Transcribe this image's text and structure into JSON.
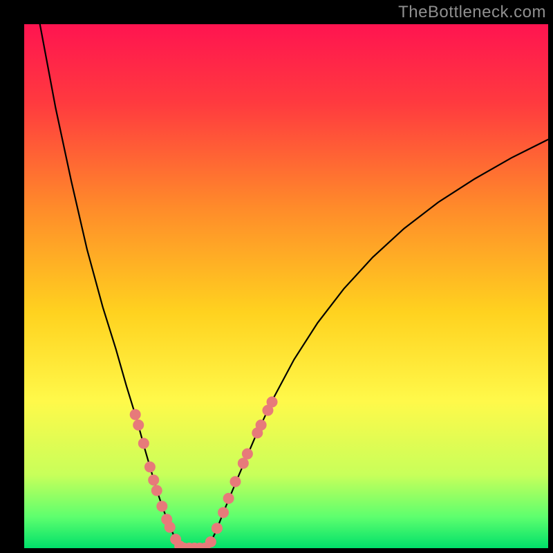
{
  "watermark": "TheBottleneck.com",
  "chart_data": {
    "type": "line",
    "title": "",
    "xlabel": "",
    "ylabel": "",
    "xlim": [
      0,
      100
    ],
    "ylim": [
      0,
      100
    ],
    "background": {
      "type": "vertical-gradient",
      "stops": [
        {
          "offset": 0,
          "color": "#ff1450"
        },
        {
          "offset": 15,
          "color": "#ff3a3f"
        },
        {
          "offset": 35,
          "color": "#ff8b2a"
        },
        {
          "offset": 55,
          "color": "#ffd21f"
        },
        {
          "offset": 72,
          "color": "#fff94a"
        },
        {
          "offset": 86,
          "color": "#c8ff5a"
        },
        {
          "offset": 94,
          "color": "#5eff6e"
        },
        {
          "offset": 100,
          "color": "#00e06a"
        }
      ]
    },
    "series": [
      {
        "name": "left-branch",
        "color": "#000000",
        "x": [
          3,
          6,
          9,
          12,
          15,
          17.5,
          19.5,
          21.5,
          23,
          24.3,
          25.5,
          26.5,
          27.5,
          28.3,
          29,
          29.5,
          30
        ],
        "y": [
          100,
          84,
          70,
          57,
          46,
          38,
          31,
          24.5,
          19,
          14.5,
          10.5,
          7.5,
          5,
          3,
          1.5,
          0.5,
          0
        ]
      },
      {
        "name": "valley-floor",
        "color": "#000000",
        "x": [
          30,
          31,
          32,
          33,
          34,
          35
        ],
        "y": [
          0,
          0,
          0,
          0,
          0,
          0
        ]
      },
      {
        "name": "right-branch",
        "color": "#000000",
        "x": [
          35,
          36.5,
          38.5,
          41,
          44,
          47.5,
          51.5,
          56,
          61,
          66.5,
          72.5,
          79,
          86,
          93,
          100
        ],
        "y": [
          0,
          3,
          8,
          14,
          21,
          28.5,
          36,
          43,
          49.5,
          55.5,
          61,
          66,
          70.5,
          74.5,
          78
        ]
      }
    ],
    "markers": [
      {
        "name": "left-dots",
        "color": "#e77a7a",
        "radius": 8,
        "points": [
          {
            "x": 21.2,
            "y": 25.5
          },
          {
            "x": 21.8,
            "y": 23.5
          },
          {
            "x": 22.8,
            "y": 20.0
          },
          {
            "x": 24.0,
            "y": 15.5
          },
          {
            "x": 24.7,
            "y": 13.0
          },
          {
            "x": 25.3,
            "y": 11.0
          },
          {
            "x": 26.3,
            "y": 8.0
          },
          {
            "x": 27.2,
            "y": 5.5
          },
          {
            "x": 27.8,
            "y": 4.0
          },
          {
            "x": 28.9,
            "y": 1.7
          },
          {
            "x": 29.7,
            "y": 0.4
          }
        ]
      },
      {
        "name": "floor-dots",
        "color": "#e77a7a",
        "radius": 8,
        "points": [
          {
            "x": 30.5,
            "y": 0
          },
          {
            "x": 31.5,
            "y": 0
          },
          {
            "x": 32.5,
            "y": 0
          },
          {
            "x": 33.5,
            "y": 0
          },
          {
            "x": 34.5,
            "y": 0
          }
        ]
      },
      {
        "name": "right-dots",
        "color": "#e77a7a",
        "radius": 8,
        "points": [
          {
            "x": 35.6,
            "y": 1.2
          },
          {
            "x": 36.8,
            "y": 3.8
          },
          {
            "x": 38.0,
            "y": 6.8
          },
          {
            "x": 39.0,
            "y": 9.5
          },
          {
            "x": 40.3,
            "y": 12.7
          },
          {
            "x": 41.8,
            "y": 16.2
          },
          {
            "x": 42.6,
            "y": 18.0
          },
          {
            "x": 44.5,
            "y": 22.0
          },
          {
            "x": 45.2,
            "y": 23.5
          },
          {
            "x": 46.5,
            "y": 26.3
          },
          {
            "x": 47.3,
            "y": 27.9
          }
        ]
      }
    ]
  },
  "colors": {
    "frame": "#000000",
    "curve": "#000000",
    "dots": "#e77a7a",
    "watermark": "#8f8f8f"
  }
}
